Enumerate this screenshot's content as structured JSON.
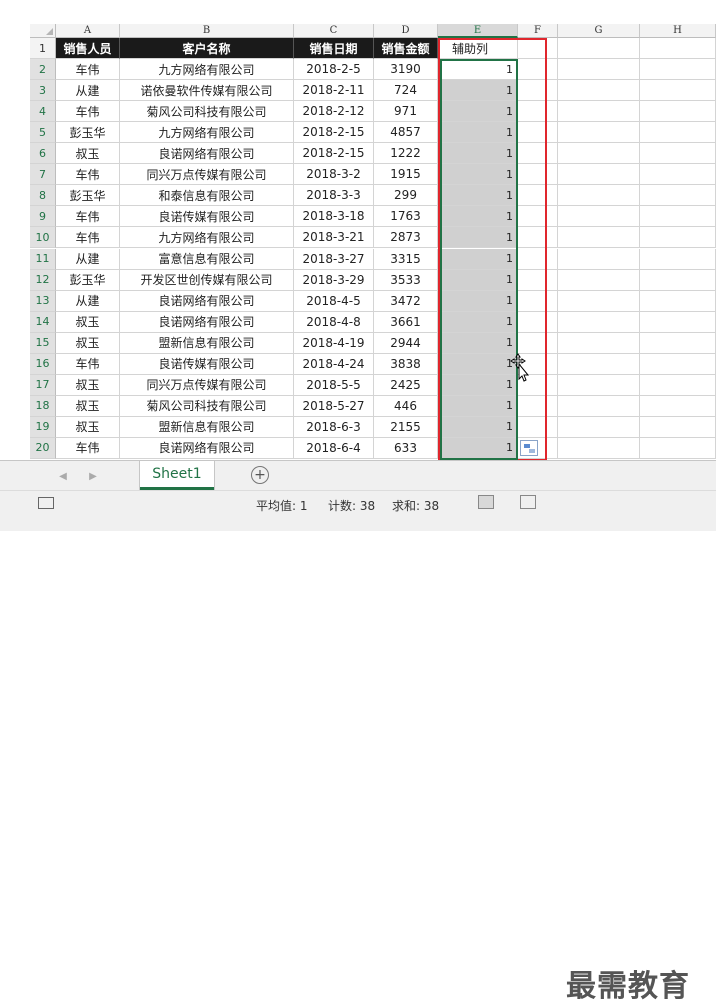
{
  "columns": [
    "A",
    "B",
    "C",
    "D",
    "E",
    "F",
    "G",
    "H"
  ],
  "header_row": {
    "row_number": "1",
    "cells": [
      "销售人员",
      "客户名称",
      "销售日期",
      "销售金额",
      "辅助列"
    ]
  },
  "rows": [
    {
      "n": "2",
      "a": "车伟",
      "b": "九方网络有限公司",
      "c": "2018-2-5",
      "d": "3190",
      "e": "1"
    },
    {
      "n": "3",
      "a": "从建",
      "b": "诺依曼软件传媒有限公司",
      "c": "2018-2-11",
      "d": "724",
      "e": "1"
    },
    {
      "n": "4",
      "a": "车伟",
      "b": "菊风公司科技有限公司",
      "c": "2018-2-12",
      "d": "971",
      "e": "1"
    },
    {
      "n": "5",
      "a": "彭玉华",
      "b": "九方网络有限公司",
      "c": "2018-2-15",
      "d": "4857",
      "e": "1"
    },
    {
      "n": "6",
      "a": "叔玉",
      "b": "良诺网络有限公司",
      "c": "2018-2-15",
      "d": "1222",
      "e": "1"
    },
    {
      "n": "7",
      "a": "车伟",
      "b": "同兴万点传媒有限公司",
      "c": "2018-3-2",
      "d": "1915",
      "e": "1"
    },
    {
      "n": "8",
      "a": "彭玉华",
      "b": "和泰信息有限公司",
      "c": "2018-3-3",
      "d": "299",
      "e": "1"
    },
    {
      "n": "9",
      "a": "车伟",
      "b": "良诺传媒有限公司",
      "c": "2018-3-18",
      "d": "1763",
      "e": "1"
    },
    {
      "n": "10",
      "a": "车伟",
      "b": "九方网络有限公司",
      "c": "2018-3-21",
      "d": "2873",
      "e": "1"
    },
    {
      "n": "11",
      "a": "从建",
      "b": "富意信息有限公司",
      "c": "2018-3-27",
      "d": "3315",
      "e": "1"
    },
    {
      "n": "12",
      "a": "彭玉华",
      "b": "开发区世创传媒有限公司",
      "c": "2018-3-29",
      "d": "3533",
      "e": "1"
    },
    {
      "n": "13",
      "a": "从建",
      "b": "良诺网络有限公司",
      "c": "2018-4-5",
      "d": "3472",
      "e": "1"
    },
    {
      "n": "14",
      "a": "叔玉",
      "b": "良诺网络有限公司",
      "c": "2018-4-8",
      "d": "3661",
      "e": "1"
    },
    {
      "n": "15",
      "a": "叔玉",
      "b": "盟新信息有限公司",
      "c": "2018-4-19",
      "d": "2944",
      "e": "1"
    },
    {
      "n": "16",
      "a": "车伟",
      "b": "良诺传媒有限公司",
      "c": "2018-4-24",
      "d": "3838",
      "e": "1"
    },
    {
      "n": "17",
      "a": "叔玉",
      "b": "同兴万点传媒有限公司",
      "c": "2018-5-5",
      "d": "2425",
      "e": "1"
    },
    {
      "n": "18",
      "a": "叔玉",
      "b": "菊风公司科技有限公司",
      "c": "2018-5-27",
      "d": "446",
      "e": "1"
    },
    {
      "n": "19",
      "a": "叔玉",
      "b": "盟新信息有限公司",
      "c": "2018-6-3",
      "d": "2155",
      "e": "1"
    },
    {
      "n": "20",
      "a": "车伟",
      "b": "良诺网络有限公司",
      "c": "2018-6-4",
      "d": "633",
      "e": "1"
    }
  ],
  "tabs": {
    "sheet_name": "Sheet1",
    "add_label": "+",
    "prev_arrow": "◀",
    "next_arrow": "▶"
  },
  "status": {
    "average": "平均值: 1",
    "count": "计数: 38",
    "sum": "求和: 38"
  },
  "watermark": "最需教育",
  "colors": {
    "header_fill": "#1a1a1a",
    "selection_fill": "#d0d0d0",
    "highlight_border": "#e0262d",
    "excel_green": "#217346"
  }
}
